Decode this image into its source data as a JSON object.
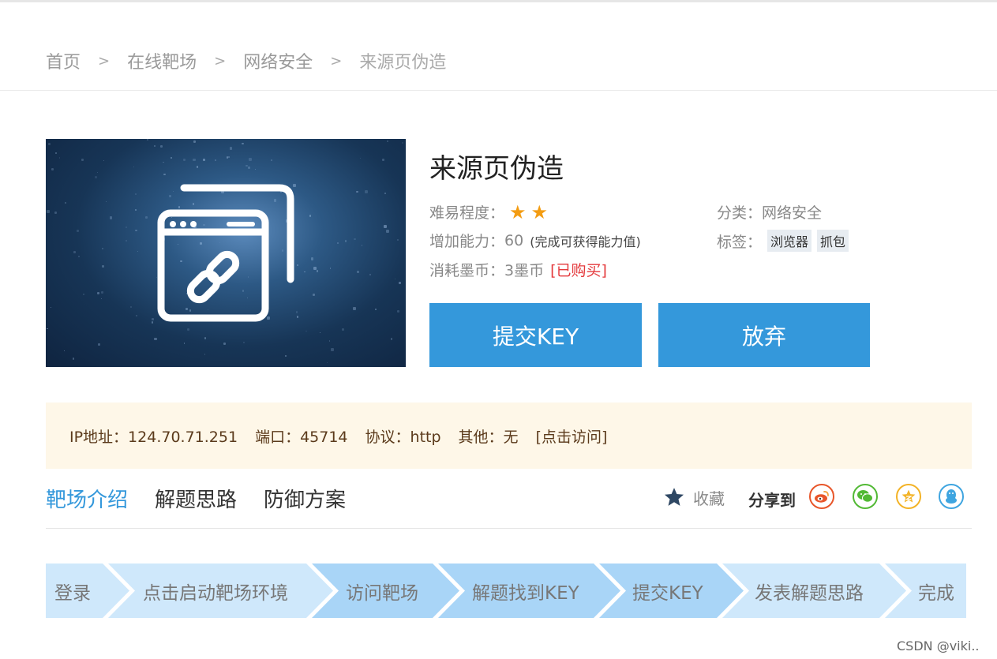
{
  "breadcrumb": {
    "items": [
      "首页",
      "在线靶场",
      "网络安全",
      "来源页伪造"
    ],
    "separator": ">"
  },
  "challenge": {
    "title": "来源页伪造",
    "difficulty_label": "难易程度：",
    "difficulty_stars": 2,
    "category_label": "分类：",
    "category_value": "网络安全",
    "ability_label": "增加能力：",
    "ability_value": "60",
    "ability_note": "(完成可获得能力值)",
    "tags_label": "标签：",
    "tags": [
      "浏览器",
      "抓包"
    ],
    "cost_label": "消耗墨币：",
    "cost_value": "3墨币",
    "bought_badge": "[已购买]"
  },
  "buttons": {
    "submit": "提交KEY",
    "abandon": "放弃"
  },
  "target": {
    "ip_text": "IP地址：124.70.71.251",
    "port_text": "端口：45714",
    "protocol_text": "协议：http",
    "other_text": "其他：无",
    "visit_link": "[点击访问]"
  },
  "tabs": [
    "靶场介绍",
    "解题思路",
    "防御方案"
  ],
  "actions": {
    "favorite": "收藏",
    "share": "分享到"
  },
  "steps": [
    "登录",
    "点击启动靶场环境",
    "访问靶场",
    "解题找到KEY",
    "提交KEY",
    "发表解题思路",
    "完成"
  ],
  "watermark": "CSDN @viki..",
  "colors": {
    "accent": "#3498db",
    "star": "#f39c12",
    "bought": "#e4393c",
    "ip_box_bg": "#fef7e8",
    "step_light": "#cfe8fb",
    "step_active": "#a9d5f7",
    "weibo": "#e8562a",
    "wechat": "#52b935",
    "qzone": "#f3b327",
    "qq": "#3fa5e0"
  }
}
